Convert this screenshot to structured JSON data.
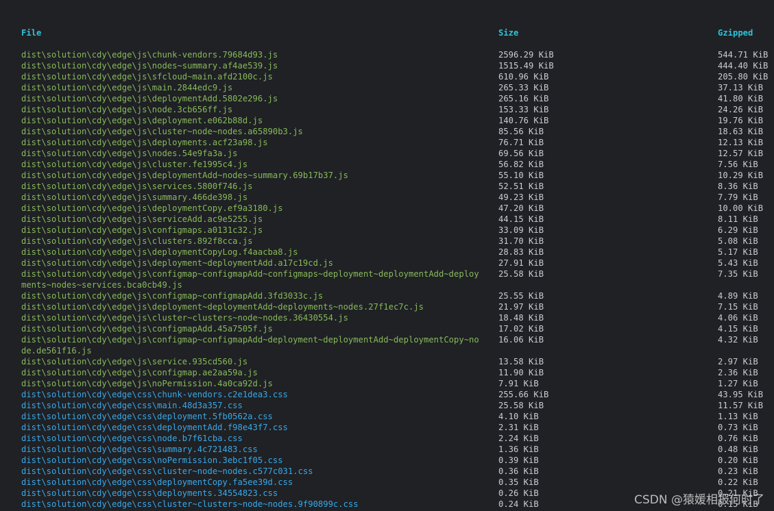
{
  "colors": {
    "background": "#1f2125",
    "header": "#2fc3d8",
    "js_file": "#88b959",
    "css_file": "#3aa8e8",
    "value": "#c9cdd3"
  },
  "header": {
    "file": "File",
    "size": "Size",
    "gzipped": "Gzipped"
  },
  "rows": [
    {
      "type": "js",
      "file": "dist\\solution\\cdy\\edge\\js\\chunk-vendors.79684d93.js",
      "size": "2596.29 KiB",
      "gzipped": "544.71 KiB"
    },
    {
      "type": "js",
      "file": "dist\\solution\\cdy\\edge\\js\\nodes~summary.af4ae539.js",
      "size": "1515.49 KiB",
      "gzipped": "444.40 KiB"
    },
    {
      "type": "js",
      "file": "dist\\solution\\cdy\\edge\\js\\sfcloud~main.afd2100c.js",
      "size": "610.96 KiB",
      "gzipped": "205.80 KiB"
    },
    {
      "type": "js",
      "file": "dist\\solution\\cdy\\edge\\js\\main.2844edc9.js",
      "size": "265.33 KiB",
      "gzipped": "37.13 KiB"
    },
    {
      "type": "js",
      "file": "dist\\solution\\cdy\\edge\\js\\deploymentAdd.5802e296.js",
      "size": "265.16 KiB",
      "gzipped": "41.80 KiB"
    },
    {
      "type": "js",
      "file": "dist\\solution\\cdy\\edge\\js\\node.3cb656ff.js",
      "size": "153.33 KiB",
      "gzipped": "24.26 KiB"
    },
    {
      "type": "js",
      "file": "dist\\solution\\cdy\\edge\\js\\deployment.e062b88d.js",
      "size": "140.76 KiB",
      "gzipped": "19.76 KiB"
    },
    {
      "type": "js",
      "file": "dist\\solution\\cdy\\edge\\js\\cluster~node~nodes.a65890b3.js",
      "size": "85.56 KiB",
      "gzipped": "18.63 KiB"
    },
    {
      "type": "js",
      "file": "dist\\solution\\cdy\\edge\\js\\deployments.acf23a98.js",
      "size": "76.71 KiB",
      "gzipped": "12.13 KiB"
    },
    {
      "type": "js",
      "file": "dist\\solution\\cdy\\edge\\js\\nodes.54e9fa3a.js",
      "size": "69.56 KiB",
      "gzipped": "12.57 KiB"
    },
    {
      "type": "js",
      "file": "dist\\solution\\cdy\\edge\\js\\cluster.fe1995c4.js",
      "size": "56.82 KiB",
      "gzipped": "7.56 KiB"
    },
    {
      "type": "js",
      "file": "dist\\solution\\cdy\\edge\\js\\deploymentAdd~nodes~summary.69b17b37.js",
      "size": "55.10 KiB",
      "gzipped": "10.29 KiB"
    },
    {
      "type": "js",
      "file": "dist\\solution\\cdy\\edge\\js\\services.5800f746.js",
      "size": "52.51 KiB",
      "gzipped": "8.36 KiB"
    },
    {
      "type": "js",
      "file": "dist\\solution\\cdy\\edge\\js\\summary.466de398.js",
      "size": "49.23 KiB",
      "gzipped": "7.79 KiB"
    },
    {
      "type": "js",
      "file": "dist\\solution\\cdy\\edge\\js\\deploymentCopy.ef9a3180.js",
      "size": "47.20 KiB",
      "gzipped": "10.00 KiB"
    },
    {
      "type": "js",
      "file": "dist\\solution\\cdy\\edge\\js\\serviceAdd.ac9e5255.js",
      "size": "44.15 KiB",
      "gzipped": "8.11 KiB"
    },
    {
      "type": "js",
      "file": "dist\\solution\\cdy\\edge\\js\\configmaps.a0131c32.js",
      "size": "33.09 KiB",
      "gzipped": "6.29 KiB"
    },
    {
      "type": "js",
      "file": "dist\\solution\\cdy\\edge\\js\\clusters.892f8cca.js",
      "size": "31.70 KiB",
      "gzipped": "5.08 KiB"
    },
    {
      "type": "js",
      "file": "dist\\solution\\cdy\\edge\\js\\deploymentCopyLog.f4aacba8.js",
      "size": "28.83 KiB",
      "gzipped": "5.17 KiB"
    },
    {
      "type": "js",
      "file": "dist\\solution\\cdy\\edge\\js\\deployment~deploymentAdd.a17c19cd.js",
      "size": "27.91 KiB",
      "gzipped": "5.43 KiB"
    },
    {
      "type": "js",
      "file": "dist\\solution\\cdy\\edge\\js\\configmap~configmapAdd~configmaps~deployment~deploymentAdd~deployments~nodes~services.bca0cb49.js",
      "size": "25.58 KiB",
      "gzipped": "7.35 KiB"
    },
    {
      "type": "js",
      "file": "dist\\solution\\cdy\\edge\\js\\configmap~configmapAdd.3fd3033c.js",
      "size": "25.55 KiB",
      "gzipped": "4.89 KiB"
    },
    {
      "type": "js",
      "file": "dist\\solution\\cdy\\edge\\js\\deployment~deploymentAdd~deployments~nodes.27f1ec7c.js",
      "size": "21.97 KiB",
      "gzipped": "7.15 KiB"
    },
    {
      "type": "js",
      "file": "dist\\solution\\cdy\\edge\\js\\cluster~clusters~node~nodes.36430554.js",
      "size": "18.48 KiB",
      "gzipped": "4.06 KiB"
    },
    {
      "type": "js",
      "file": "dist\\solution\\cdy\\edge\\js\\configmapAdd.45a7505f.js",
      "size": "17.02 KiB",
      "gzipped": "4.15 KiB"
    },
    {
      "type": "js",
      "file": "dist\\solution\\cdy\\edge\\js\\configmap~configmapAdd~deployment~deploymentAdd~deploymentCopy~node.de561f16.js",
      "size": "16.06 KiB",
      "gzipped": "4.32 KiB"
    },
    {
      "type": "js",
      "file": "dist\\solution\\cdy\\edge\\js\\service.935cd560.js",
      "size": "13.58 KiB",
      "gzipped": "2.97 KiB"
    },
    {
      "type": "js",
      "file": "dist\\solution\\cdy\\edge\\js\\configmap.ae2aa59a.js",
      "size": "11.90 KiB",
      "gzipped": "2.36 KiB"
    },
    {
      "type": "js",
      "file": "dist\\solution\\cdy\\edge\\js\\noPermission.4a0ca92d.js",
      "size": "7.91 KiB",
      "gzipped": "1.27 KiB"
    },
    {
      "type": "css",
      "file": "dist\\solution\\cdy\\edge\\css\\chunk-vendors.c2e1dea3.css",
      "size": "255.66 KiB",
      "gzipped": "43.95 KiB"
    },
    {
      "type": "css",
      "file": "dist\\solution\\cdy\\edge\\css\\main.48d3a357.css",
      "size": "25.58 KiB",
      "gzipped": "11.57 KiB"
    },
    {
      "type": "css",
      "file": "dist\\solution\\cdy\\edge\\css\\deployment.5fb0562a.css",
      "size": "4.10 KiB",
      "gzipped": "1.13 KiB"
    },
    {
      "type": "css",
      "file": "dist\\solution\\cdy\\edge\\css\\deploymentAdd.f98e43f7.css",
      "size": "2.31 KiB",
      "gzipped": "0.73 KiB"
    },
    {
      "type": "css",
      "file": "dist\\solution\\cdy\\edge\\css\\node.b7f61cba.css",
      "size": "2.24 KiB",
      "gzipped": "0.76 KiB"
    },
    {
      "type": "css",
      "file": "dist\\solution\\cdy\\edge\\css\\summary.4c721483.css",
      "size": "1.36 KiB",
      "gzipped": "0.48 KiB"
    },
    {
      "type": "css",
      "file": "dist\\solution\\cdy\\edge\\css\\noPermission.3ebc1f05.css",
      "size": "0.39 KiB",
      "gzipped": "0.20 KiB"
    },
    {
      "type": "css",
      "file": "dist\\solution\\cdy\\edge\\css\\cluster~node~nodes.c577c031.css",
      "size": "0.36 KiB",
      "gzipped": "0.23 KiB"
    },
    {
      "type": "css",
      "file": "dist\\solution\\cdy\\edge\\css\\deploymentCopy.fa5ee39d.css",
      "size": "0.35 KiB",
      "gzipped": "0.22 KiB"
    },
    {
      "type": "css",
      "file": "dist\\solution\\cdy\\edge\\css\\deployments.34554823.css",
      "size": "0.26 KiB",
      "gzipped": "0.21 KiB"
    },
    {
      "type": "css",
      "file": "dist\\solution\\cdy\\edge\\css\\cluster~clusters~node~nodes.9f90899c.css",
      "size": "0.24 KiB",
      "gzipped": "0.15 KiB"
    }
  ],
  "watermark": "CSDN @猿媛相报何时了"
}
